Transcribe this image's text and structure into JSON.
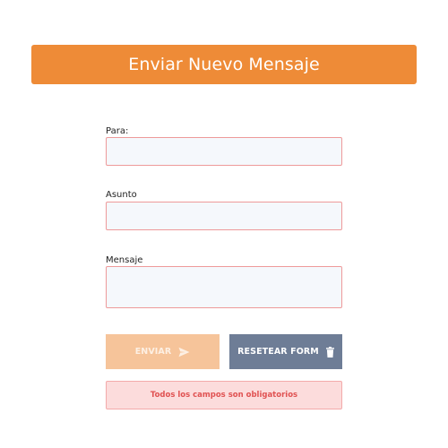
{
  "header": {
    "title": "Enviar Nuevo Mensaje"
  },
  "form": {
    "to": {
      "label": "Para:",
      "value": "",
      "placeholder": ""
    },
    "subject": {
      "label": "Asunto",
      "value": "",
      "placeholder": ""
    },
    "message": {
      "label": "Mensaje",
      "value": "",
      "placeholder": ""
    }
  },
  "buttons": {
    "send_label": "ENVIAR",
    "send_icon": "paper-plane-icon",
    "reset_label": "RESETEAR FORM",
    "reset_icon": "trash-icon"
  },
  "alert": {
    "text": "Todos los campos son obligatorios"
  },
  "colors": {
    "header": "#ee8b37",
    "send_button": "#f6c49a",
    "reset_button": "#6e7d96",
    "alert_bg": "#fcdcdc",
    "alert_text": "#e05252",
    "input_border": "#ee9a9a"
  }
}
